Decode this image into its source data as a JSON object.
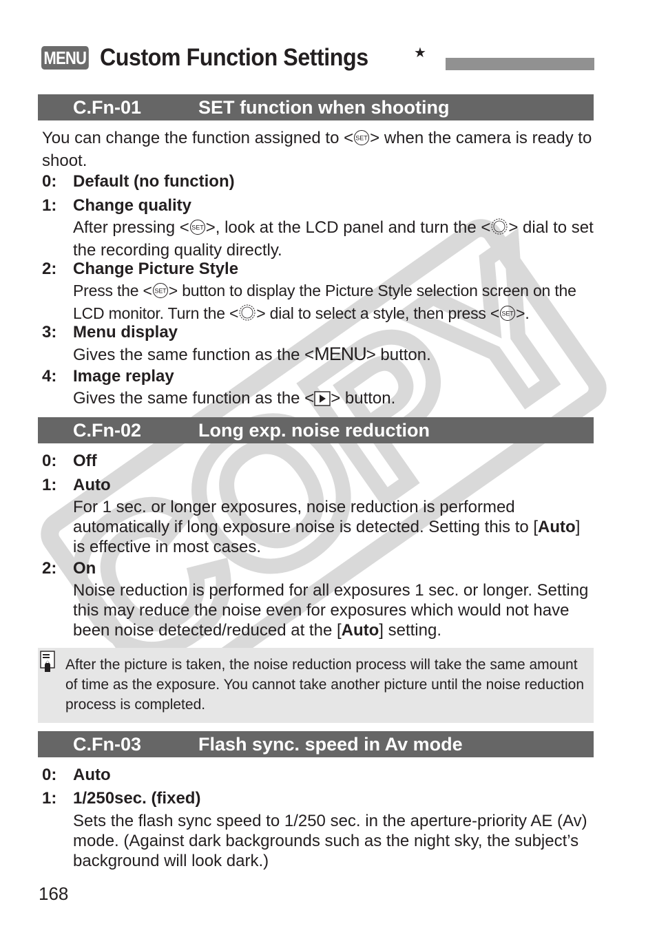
{
  "page": {
    "title_badge": "MENU",
    "title": "Custom Function Settings",
    "title_star": "★",
    "page_number": "168",
    "watermark": "COPY"
  },
  "sections": [
    {
      "code": "C.Fn-01",
      "name": "SET function when shooting",
      "intro_parts": [
        "You can change the function assigned to <",
        "> when the camera is ready to shoot."
      ],
      "options": [
        {
          "num": "0:",
          "label": "Default (no function)"
        },
        {
          "num": "1:",
          "label": "Change quality",
          "desc_parts": [
            "After pressing <",
            ">, look at the LCD panel and turn the <",
            "> dial to set the recording quality directly."
          ]
        },
        {
          "num": "2:",
          "label": "Change Picture Style",
          "desc_parts": [
            "Press the <",
            "> button to display the Picture Style selection screen on the LCD monitor. Turn the <",
            "> dial to select a style, then press <",
            ">."
          ]
        },
        {
          "num": "3:",
          "label": "Menu display",
          "desc_parts": [
            "Gives the same function as the <",
            "MENU",
            "> button."
          ]
        },
        {
          "num": "4:",
          "label": "Image replay",
          "desc_parts": [
            "Gives the same function as the <",
            "> button."
          ]
        }
      ]
    },
    {
      "code": "C.Fn-02",
      "name": "Long exp. noise reduction",
      "options": [
        {
          "num": "0:",
          "label": "Off"
        },
        {
          "num": "1:",
          "label": "Auto",
          "desc_parts": [
            "For 1 sec. or longer exposures, noise reduction is performed automatically if long exposure noise is detected. Setting this to [",
            "Auto",
            "] is effective in most cases."
          ]
        },
        {
          "num": "2:",
          "label": "On",
          "desc_parts": [
            "Noise reduction is performed for all exposures 1 sec. or longer. Setting this may reduce the noise even for exposures which would not have been noise detected/reduced at the [",
            "Auto",
            "] setting."
          ]
        }
      ],
      "note": "After the picture is taken, the noise reduction process will take the same amount of time as the exposure. You cannot take another picture until the noise reduction process is completed."
    },
    {
      "code": "C.Fn-03",
      "name": "Flash sync. speed in Av mode",
      "options": [
        {
          "num": "0:",
          "label": "Auto"
        },
        {
          "num": "1:",
          "label": "1/250sec. (fixed)",
          "desc_parts": [
            "Sets the flash sync speed to 1/250 sec. in the aperture-priority AE (Av) mode. (Against dark backgrounds such as the night sky, the subject’s background will look dark.)"
          ]
        }
      ]
    }
  ],
  "icons": {
    "set_button": "SET",
    "dial": "quick-control-dial",
    "playback": "▶",
    "note": "note-pencil"
  },
  "colors": {
    "section_header_bg": "#666666",
    "title_bar": "#919191",
    "note_bg": "#e6e6e6",
    "watermark": "#dcdcdc"
  }
}
